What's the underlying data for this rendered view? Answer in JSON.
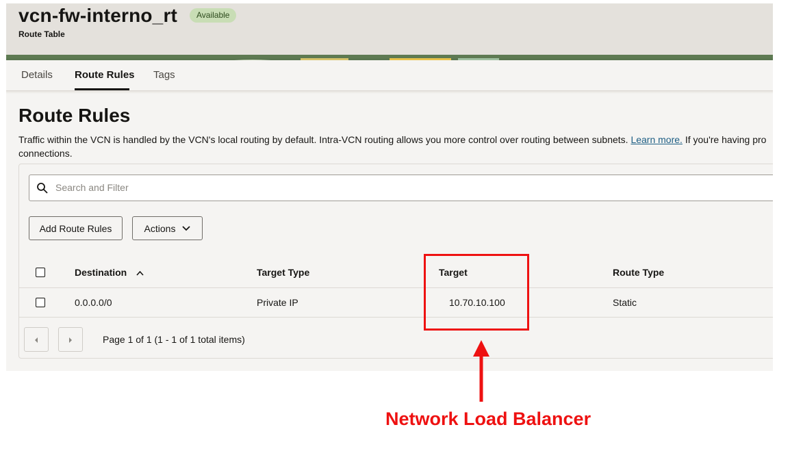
{
  "header": {
    "title": "vcn-fw-interno_rt",
    "status_badge": "Available",
    "subtitle": "Route Table"
  },
  "tabs": [
    {
      "label": "Details"
    },
    {
      "label": "Route Rules",
      "active": true
    },
    {
      "label": "Tags"
    }
  ],
  "section": {
    "title": "Route Rules",
    "description_part1": "Traffic within the VCN is handled by the VCN's local routing by default. Intra-VCN routing allows you more control over routing between subnets.",
    "learn_more": "Learn more.",
    "description_part2": "If you're having pro",
    "description_line2": "connections."
  },
  "search": {
    "placeholder": "Search and Filter"
  },
  "toolbar": {
    "add_label": "Add Route Rules",
    "actions_label": "Actions"
  },
  "table": {
    "columns": [
      "Destination",
      "Target Type",
      "Target",
      "Route Type"
    ],
    "rows": [
      {
        "destination": "0.0.0.0/0",
        "target_type": "Private IP",
        "target": "10.70.10.100",
        "route_type": "Static"
      }
    ]
  },
  "pagination": {
    "text": "Page 1 of 1 (1 - 1 of 1 total items)"
  },
  "annotation": {
    "label": "Network Load Balancer",
    "color": "#ee1111"
  },
  "colors": {
    "badge_bg": "#c8ddb5",
    "link": "#1d5e84",
    "header_bg": "#e4e1dc"
  }
}
